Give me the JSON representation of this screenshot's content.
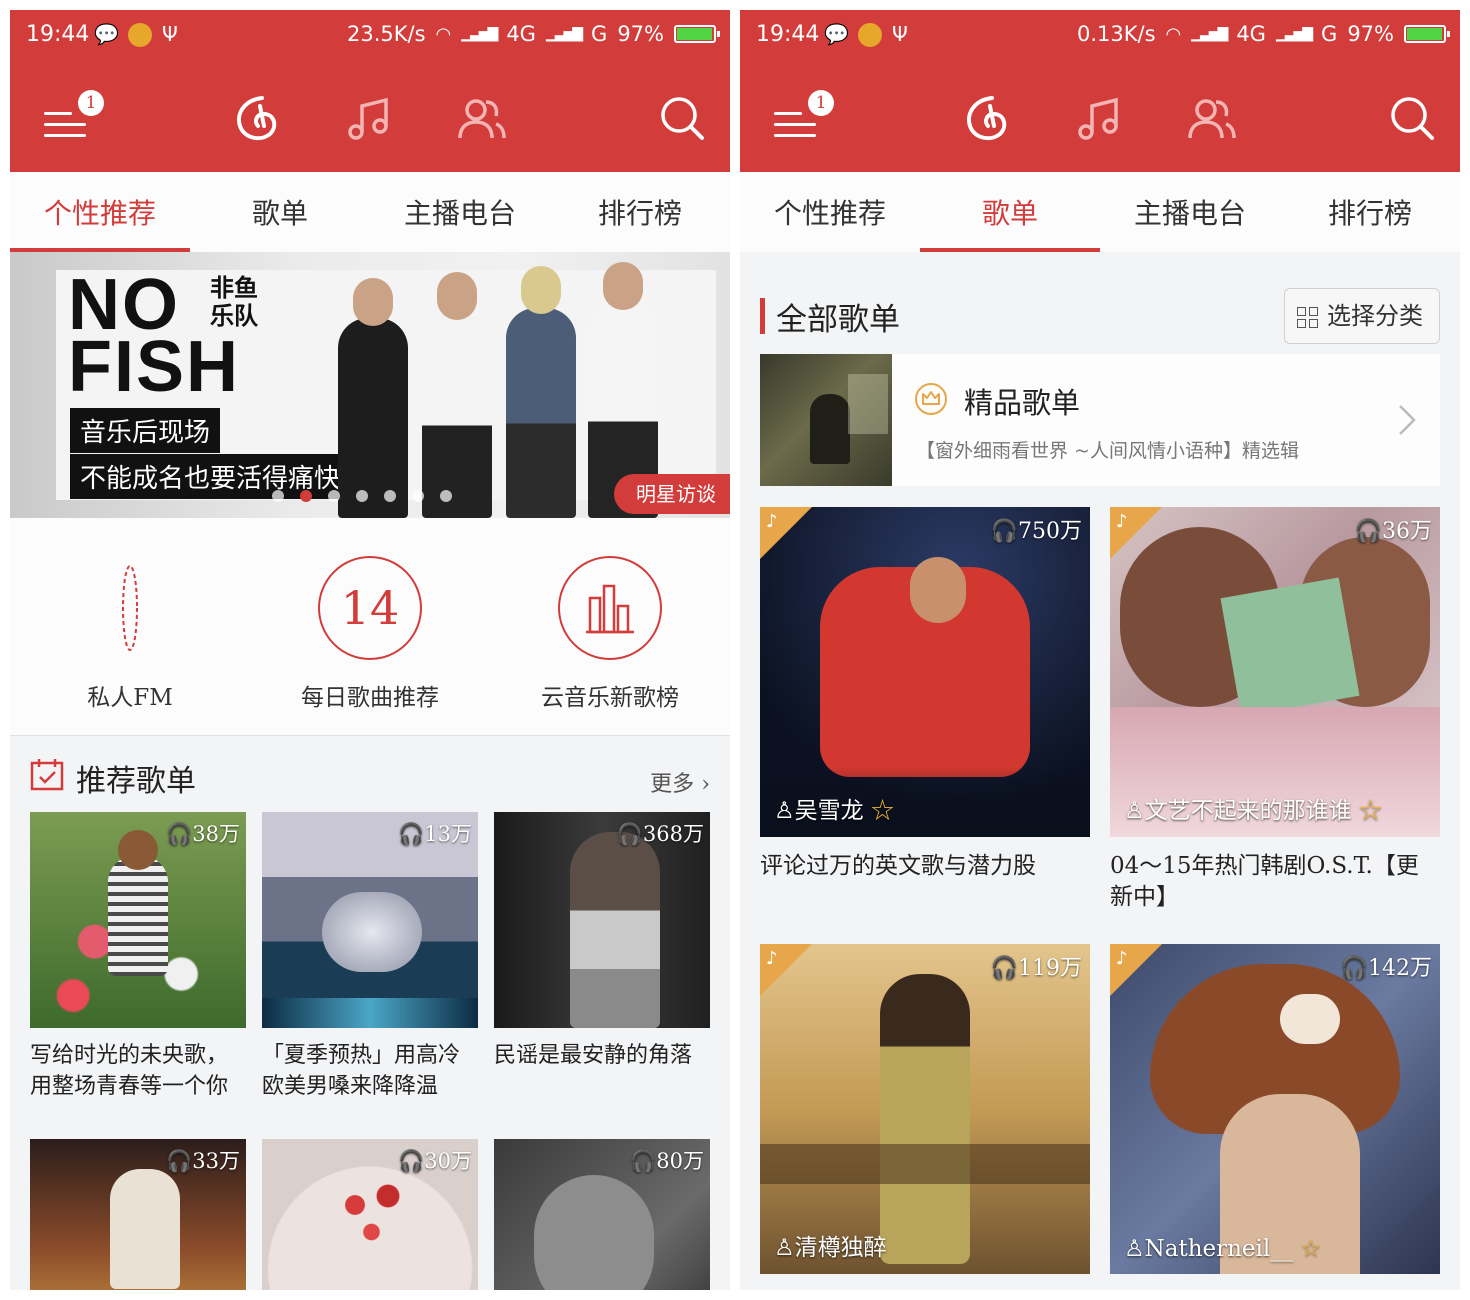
{
  "status_left": {
    "time": "19:44",
    "speed": "23.5K/s",
    "net1": "4G",
    "net2": "G",
    "battery": "97%",
    "battery_level": 0.97
  },
  "status_right": {
    "time": "19:44",
    "speed": "0.13K/s",
    "net1": "4G",
    "net2": "G",
    "battery": "97%",
    "battery_level": 0.97
  },
  "topbar": {
    "menu_badge": "1",
    "icons": [
      "netease-cloud-logo-icon",
      "music-note-icon",
      "friends-icon",
      "search-icon"
    ]
  },
  "tabs": [
    "个性推荐",
    "歌单",
    "主播电台",
    "排行榜"
  ],
  "left": {
    "active_tab": 0,
    "banner": {
      "line1": "NO",
      "line2": "FISH",
      "band": [
        "非鱼",
        "乐队"
      ],
      "caption1": "音乐后现场",
      "caption2": "不能成名也要活得痛快",
      "tag": "明星访谈",
      "dot_count": 7,
      "active_dot": 1
    },
    "quick": [
      {
        "label": "私人FM",
        "icon": "radio-icon"
      },
      {
        "label": "每日歌曲推荐",
        "value": "14"
      },
      {
        "label": "云音乐新歌榜",
        "icon": "chart-bars-icon"
      }
    ],
    "section": {
      "title": "推荐歌单",
      "more": "更多"
    },
    "cards": [
      {
        "plays": "38万",
        "name": "写给时光的未央歌，用整场青春等一个你"
      },
      {
        "plays": "13万",
        "name": "「夏季预热」用高冷欧美男嗓来降降温"
      },
      {
        "plays": "368万",
        "name": "民谣是最安静的角落"
      },
      {
        "plays": "33万",
        "name": ""
      },
      {
        "plays": "30万",
        "name": ""
      },
      {
        "plays": "80万",
        "name": ""
      }
    ]
  },
  "right": {
    "active_tab": 1,
    "header": {
      "title": "全部歌单",
      "category_button": "选择分类"
    },
    "featured": {
      "title": "精品歌单",
      "subtitle": "【窗外细雨看世界 ~人间风情小语种】精选辑"
    },
    "cards": [
      {
        "plays": "750万",
        "creator": "吴雪龙",
        "name": "评论过万的英文歌与潜力股"
      },
      {
        "plays": "36万",
        "creator": "文艺不起来的那谁谁",
        "name": "04～15年热门韩剧O.S.T.【更新中】"
      },
      {
        "plays": "119万",
        "creator": "清樽独醉",
        "name": ""
      },
      {
        "plays": "142万",
        "creator": "Natherneil__",
        "name": ""
      }
    ]
  },
  "colors": {
    "brand_red": "#d23c3a",
    "badge_gold": "#e8a64a",
    "star": "#f3b632"
  }
}
